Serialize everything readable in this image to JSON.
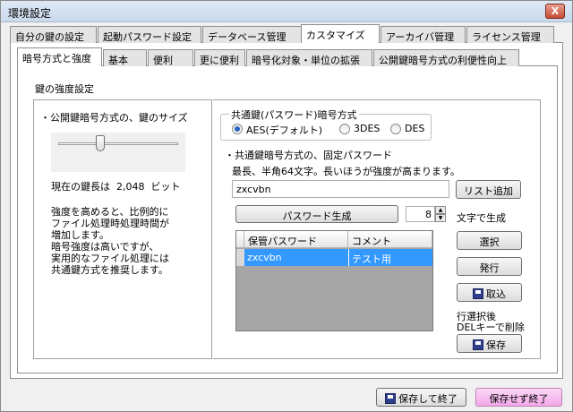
{
  "window": {
    "title": "環境設定",
    "close_label": "X"
  },
  "tabs_main": [
    "自分の鍵の設定",
    "起動パスワード設定",
    "データベース管理",
    "カスタマイズ",
    "アーカイバ管理",
    "ライセンス管理"
  ],
  "tabs_main_active": 3,
  "tabs_sub": [
    "暗号方式と強度",
    "基本",
    "便利",
    "更に便利",
    "暗号化対象・単位の拡張",
    "公開鍵暗号方式の利便性向上"
  ],
  "tabs_sub_active": 0,
  "section_title": "鍵の強度設定",
  "left": {
    "key_size_label": "・公開鍵暗号方式の、鍵のサイズ",
    "slider_value": 0.35,
    "current_key_prefix": "現在の鍵長は",
    "current_key_value": "2,048",
    "current_key_unit": "ビット",
    "description_lines": [
      "強度を高めると、比例的に",
      "ファイル処理時処理時間が",
      "増加します。",
      "暗号強度は高いですが、",
      "実用的なファイル処理には",
      "共通鍵方式を推奨します。"
    ]
  },
  "right": {
    "cipher_group_label": "共通鍵(パスワード)暗号方式",
    "cipher_options": [
      "AES(デフォルト)",
      "3DES",
      "DES"
    ],
    "cipher_selected": "AES(デフォルト)",
    "fixed_pw_label": "・共通鍵暗号方式の、固定パスワード",
    "fixed_pw_hint": "最長、半角64文字。長いほうが強度が高まります。",
    "password_value": "zxcvbn",
    "add_list_button": "リスト追加",
    "generate_button": "パスワード生成",
    "length_value": "8",
    "length_suffix": "文字で生成",
    "grid_headers": [
      "保管パスワード",
      "コメント"
    ],
    "grid_rows": [
      {
        "password": "zxcvbn",
        "comment": "テスト用"
      }
    ],
    "select_button": "選択",
    "issue_button": "発行",
    "import_button": "取込",
    "delete_hint_1": "行選択後",
    "delete_hint_2": "DELキーで削除",
    "save_button": "保存"
  },
  "footer": {
    "save_exit": "保存して終了",
    "no_save_exit": "保存せず終了"
  }
}
